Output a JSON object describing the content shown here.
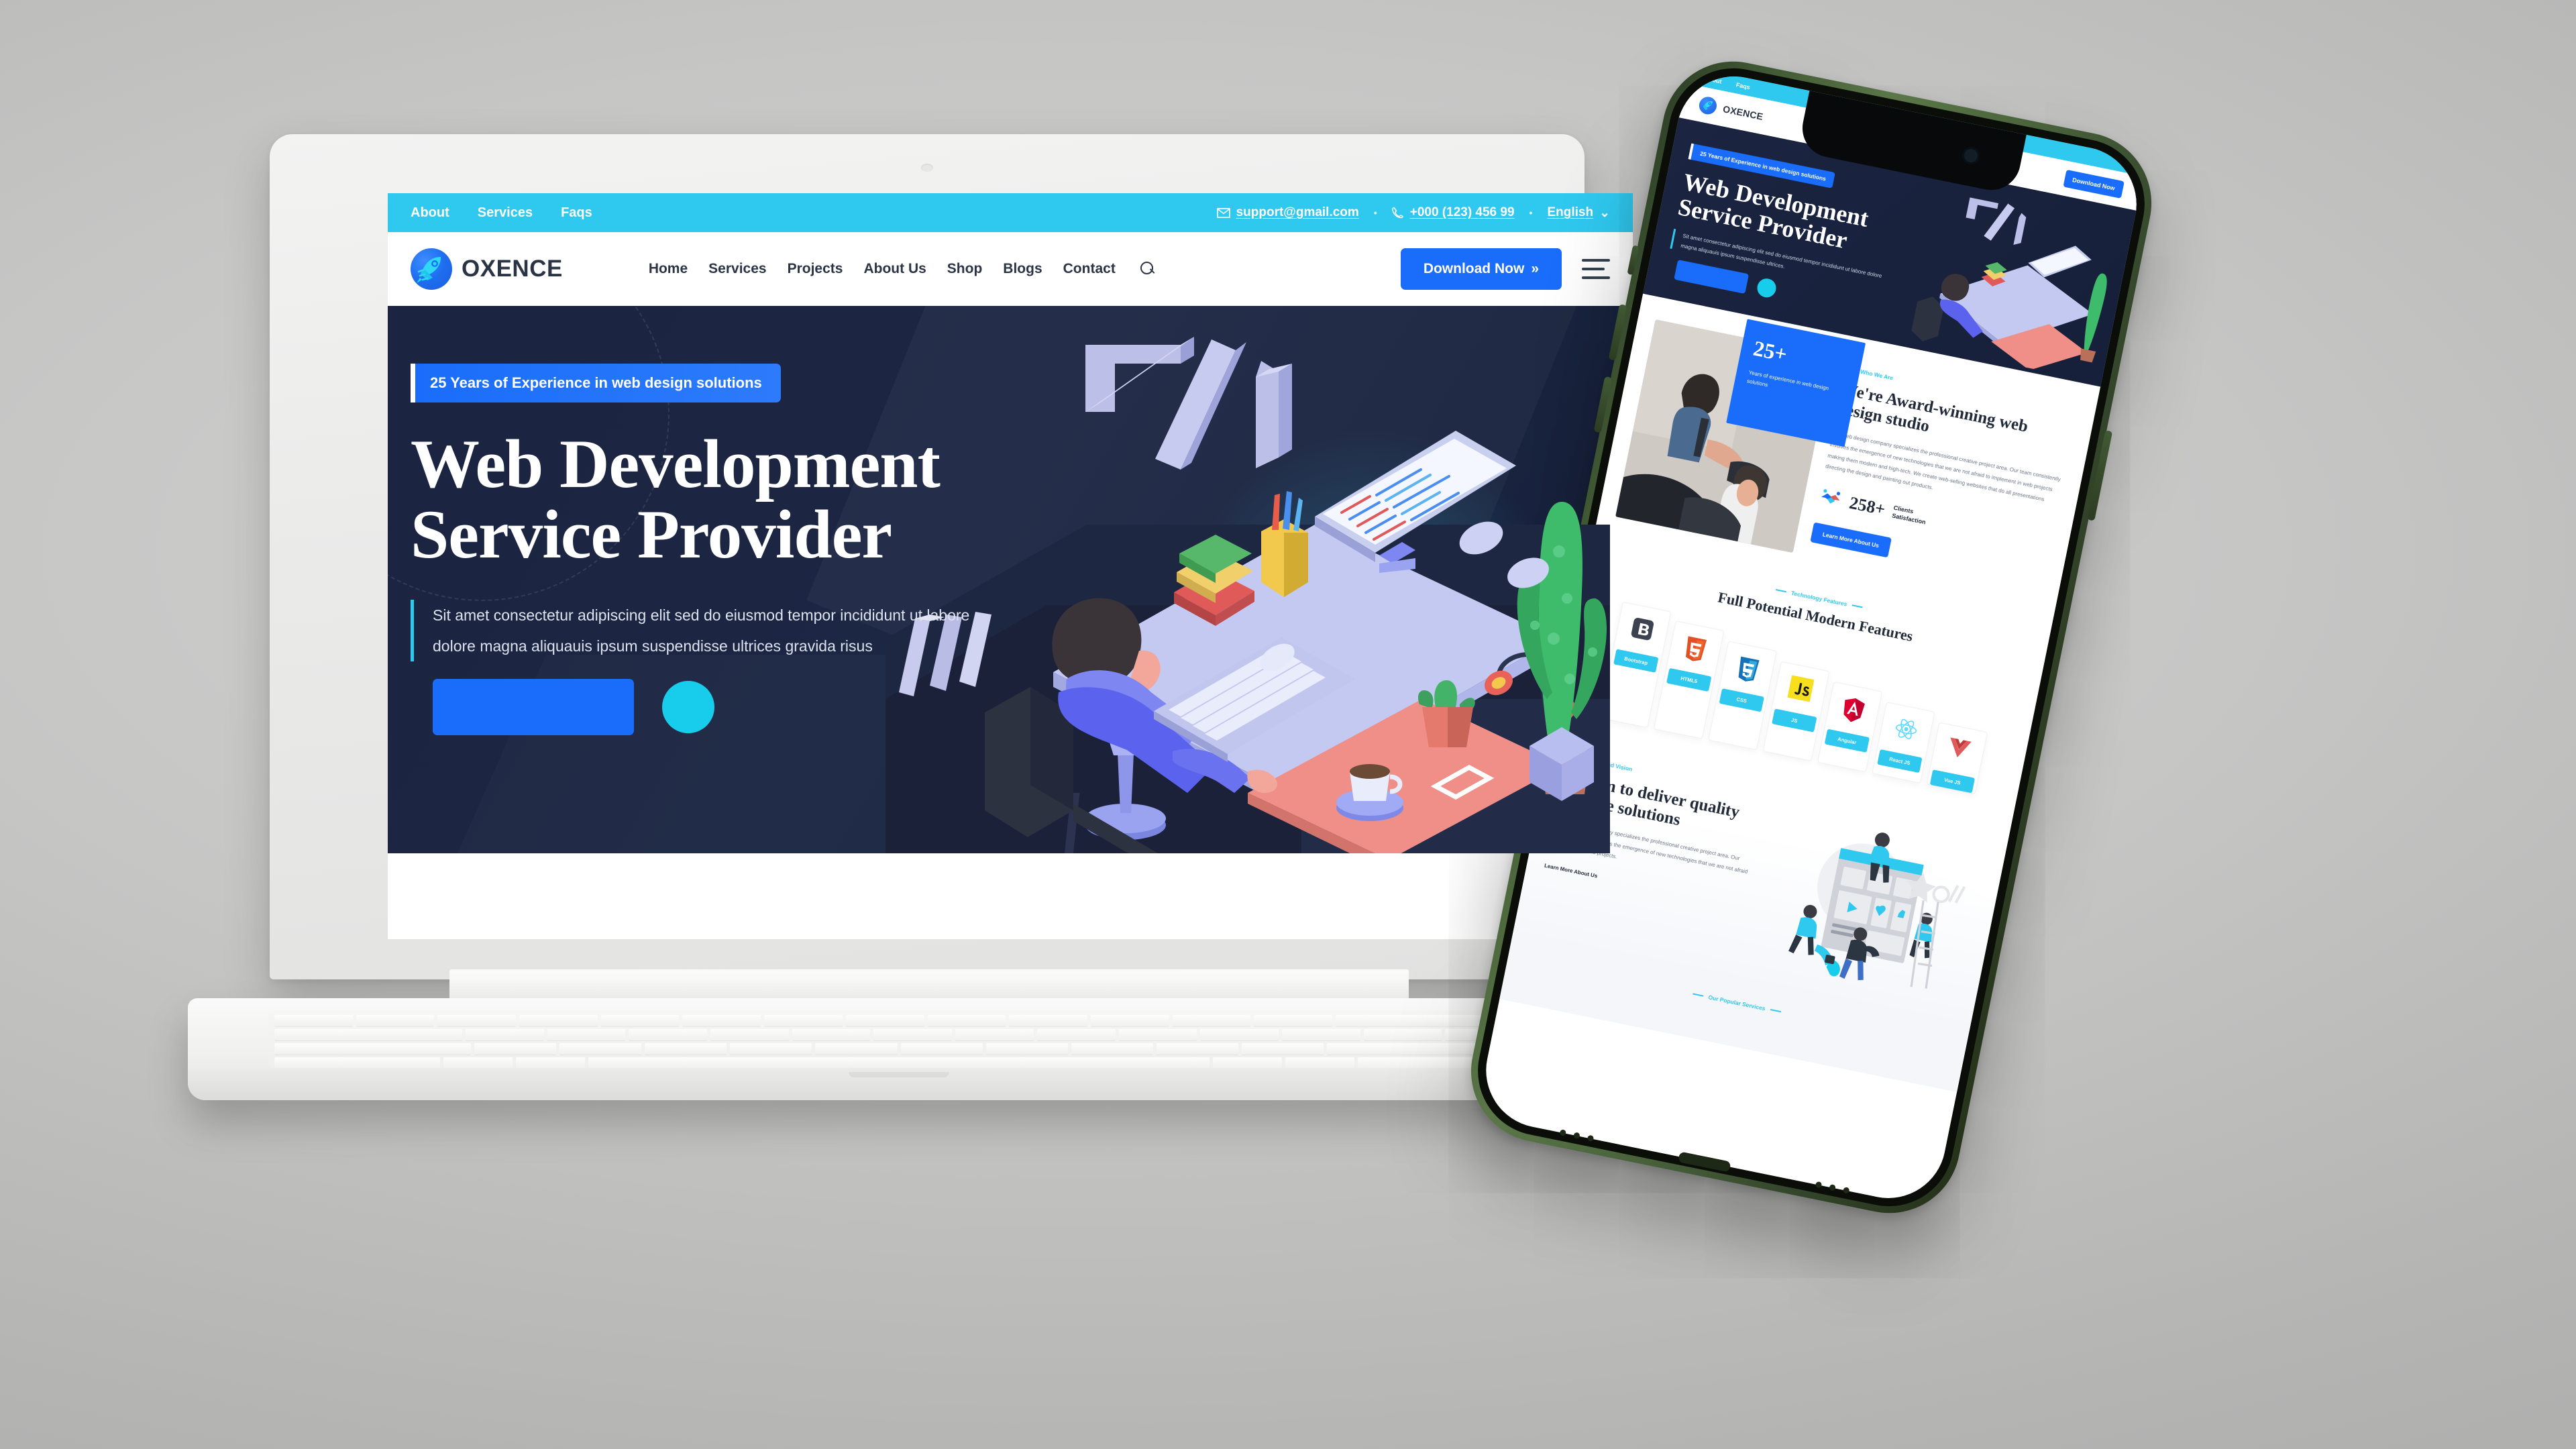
{
  "scene": {
    "background_color": "#bcbcbc",
    "devices": [
      "laptop-mockup",
      "smartphone-mockup"
    ]
  },
  "site": {
    "topbar": {
      "background_color": "#2fc8ef",
      "links": [
        "About",
        "Services",
        "Faqs"
      ],
      "email": "support@gmail.com",
      "phone": "+000 (123) 456 99",
      "language": "English",
      "separator": "•",
      "email_icon": "envelope-icon",
      "phone_icon": "phone-icon",
      "chevron": "⌄"
    },
    "navbar": {
      "brand": "OXENCE",
      "brand_icon": "rocket-logo-icon",
      "links": [
        "Home",
        "Services",
        "Projects",
        "About Us",
        "Shop",
        "Blogs",
        "Contact"
      ],
      "search_icon": "search-icon",
      "cta_label": "Download Now",
      "cta_arrow": "»",
      "cta_color": "#1a6dfa",
      "menu_icon": "hamburger-menu-icon"
    },
    "hero": {
      "badge": "25 Years of Experience in web design solutions",
      "title_line1": "Web Development",
      "title_line2": "Service Provider",
      "paragraph": "Sit amet consectetur adipiscing elit sed do eiusmod tempor incididunt ut labore dolore magna aliquauis ipsum suspendisse ultrices gravida risus",
      "primary_button": "",
      "play_button_icon": "play-icon",
      "background_color": "#1b2440",
      "accent_color": "#2fc8ef",
      "illustration": "developer-at-desk-isometric-illustration"
    }
  },
  "phone": {
    "frame_color": "#4b6339",
    "notch_icon": "front-camera-icon",
    "port_icon": "lightning-port-icon",
    "site": {
      "topbar_links": [
        "About",
        "Faqs"
      ],
      "brand": "OXENCE",
      "cta_label": "Download Now",
      "hero": {
        "badge": "25 Years of Experience in web design solutions",
        "title_line1": "Web Development",
        "title_line2": "Service Provider",
        "paragraph": "Sit amet consectetur adipiscing elit sed do eiusmod tempor incididunt ut labore dolore magna aliquauis ipsum suspendisse ultrices."
      },
      "about": {
        "experience_number": "25+",
        "experience_caption": "Years of experience in web design solutions",
        "eyebrow": "Who We Are",
        "title": "We're Award-winning web design studio",
        "body": "Our web design company specializes the professional creative project area. Our team consistently involves the emergence of new technologies that we are not afraid to implement in web projects making them modern and high-tech. We create web-selling websites that do all presentations directing the design and painting out products.",
        "stat_number": "258+",
        "stat_label": "Clients Satisfaction",
        "stat_icon": "handshake-icon",
        "button": "Learn More About Us"
      },
      "features": {
        "eyebrow": "Technology Features",
        "title": "Full Potential Modern Features",
        "items": [
          {
            "name": "Bootstrap",
            "icon": "bootstrap-logo-icon"
          },
          {
            "name": "HTML5",
            "icon": "html5-logo-icon"
          },
          {
            "name": "CSS",
            "icon": "css3-logo-icon"
          },
          {
            "name": "JS",
            "icon": "javascript-logo-icon"
          },
          {
            "name": "Angular",
            "icon": "angular-logo-icon"
          },
          {
            "name": "React JS",
            "icon": "react-logo-icon"
          },
          {
            "name": "Vue JS",
            "icon": "vuejs-logo-icon"
          }
        ]
      },
      "aim": {
        "eyebrow": "Mission and Vision",
        "title_line1": "We aim to deliver quality",
        "title_line2": "creative solutions",
        "body": "Our web design company specializes the professional creative project area. Our team consistently involves the emergence of new technologies that we are not afraid to implement in web projects.",
        "link": "Learn More About Us",
        "illustration": "team-building-website-illustration"
      },
      "footer_eyebrow": "Our Popular Services"
    }
  }
}
